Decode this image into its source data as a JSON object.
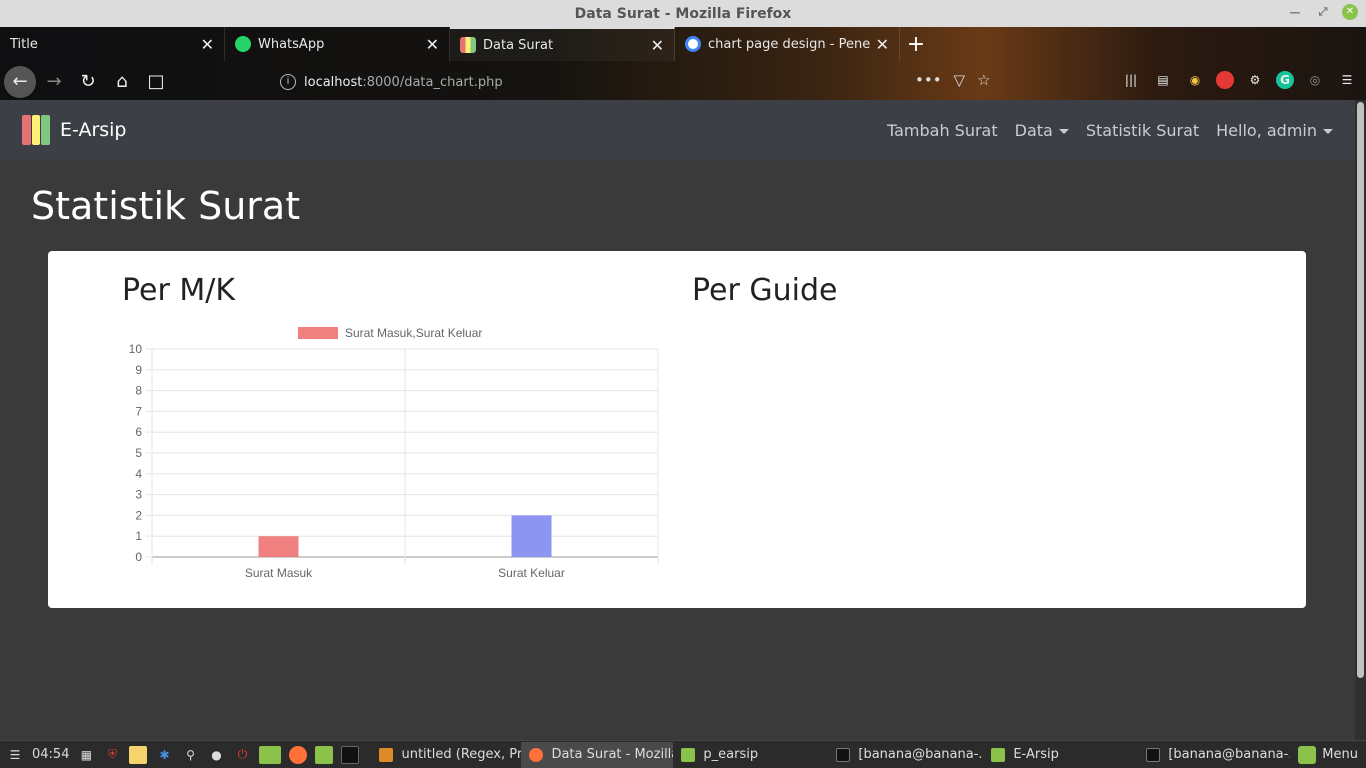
{
  "window": {
    "title": "Data Surat - Mozilla Firefox"
  },
  "browser": {
    "tabs": [
      {
        "label": "Title",
        "icon": "none"
      },
      {
        "label": "WhatsApp",
        "icon": "whatsapp-icon"
      },
      {
        "label": "Data Surat",
        "icon": "binders-icon"
      },
      {
        "label": "chart page design - Penelusur",
        "icon": "google-icon"
      }
    ],
    "url": {
      "host": "localhost",
      "path": ":8000/data_chart.php"
    }
  },
  "app": {
    "brand": "E-Arsip",
    "nav": {
      "tambah": "Tambah Surat",
      "data": "Data",
      "statistik": "Statistik Surat",
      "user": "Hello, admin"
    },
    "page_title": "Statistik Surat",
    "section_mk": "Per M/K",
    "section_guide": "Per Guide"
  },
  "chart_data": {
    "type": "bar",
    "categories": [
      "Surat Masuk",
      "Surat Keluar"
    ],
    "series": [
      {
        "name": "Surat Masuk,Surat Keluar",
        "values": [
          1,
          2
        ]
      }
    ],
    "bar_colors": [
      "#f08080",
      "#8c96f0"
    ],
    "legend_color": "#f08080",
    "ylim": [
      0,
      10
    ],
    "yticks": [
      0,
      1,
      2,
      3,
      4,
      5,
      6,
      7,
      8,
      9,
      10
    ],
    "grid": true,
    "legend_position": "top"
  },
  "taskbar": {
    "time": "04:54",
    "tasks": [
      {
        "label": "untitled (Regex, Proj...",
        "color": "#e08a2a"
      },
      {
        "label": "Data Surat - Mozilla...",
        "color": "#ff7139",
        "active": true
      },
      {
        "label": "p_earsip",
        "color": "#8bc34a"
      },
      {
        "label": "[banana@banana-...",
        "color": "#222"
      },
      {
        "label": "E-Arsip",
        "color": "#8bc34a"
      },
      {
        "label": "[banana@banana-...",
        "color": "#222"
      }
    ],
    "menu": "Menu"
  }
}
